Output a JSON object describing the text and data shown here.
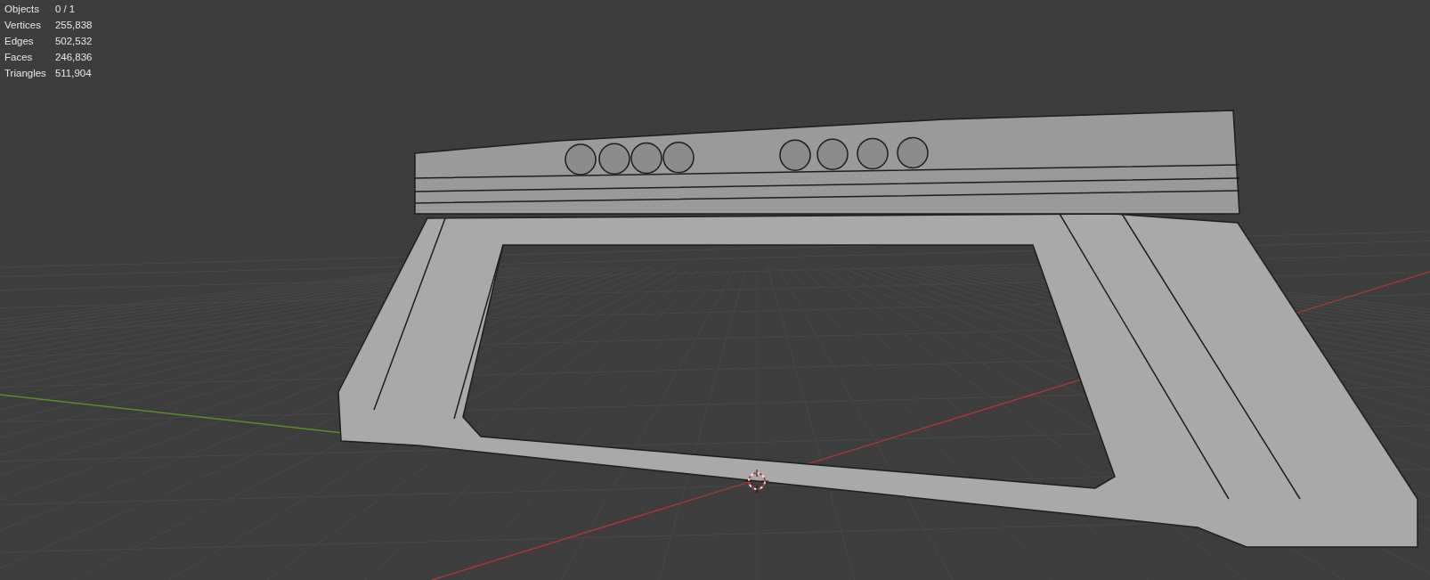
{
  "statistics": [
    {
      "label": "Objects",
      "value": "0 / 1"
    },
    {
      "label": "Vertices",
      "value": "255,838"
    },
    {
      "label": "Edges",
      "value": "502,532"
    },
    {
      "label": "Faces",
      "value": "246,836"
    },
    {
      "label": "Triangles",
      "value": "511,904"
    }
  ]
}
